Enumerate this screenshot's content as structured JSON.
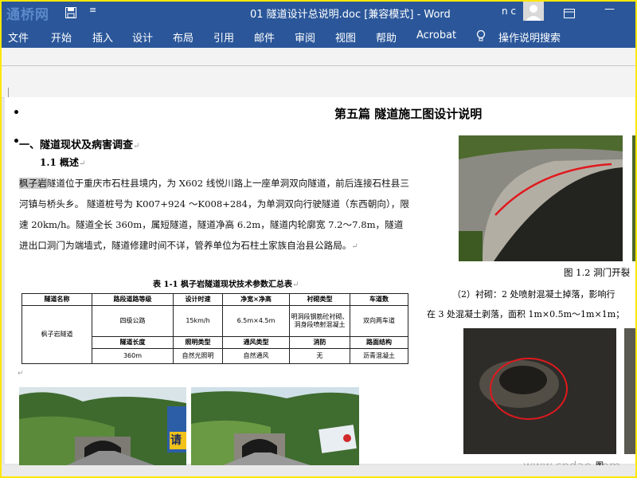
{
  "titlebar": {
    "watermark": "通桥网",
    "qat_more": "≡",
    "doc_title": "01 隧道设计总说明.doc [兼容模式]  -  Word",
    "user_name": "n c",
    "minimize": "—"
  },
  "colors": {
    "accent": "#2b579a",
    "highlight": "#c9c9c9",
    "yellow_frame": "#ffe600"
  },
  "ribbon": {
    "tabs": [
      "文件",
      "开始",
      "插入",
      "设计",
      "布局",
      "引用",
      "邮件",
      "审阅",
      "视图",
      "帮助",
      "Acrobat"
    ],
    "tell_me": "操作说明搜索"
  },
  "doc": {
    "bullet": "•",
    "part_title": "第五篇  隧道施工图设计说明",
    "section_heading": "一、隧道现状及病害调查",
    "subsection_heading": "1.1  概述",
    "para_mark": "↵",
    "paragraph_highlight": "枫子岩",
    "paragraph_text": "隧道位于重庆市石柱县境内，为 X602 线悦川路上一座单洞双向隧道，前后连接石柱县三河镇与桥头乡。 隧道桩号为 K007+924 ～K008+284，为单洞双向行驶隧道（东西朝向），限速 20km/h。隧道全长 360m，属短隧道，隧道净高 6.2m，隧道内轮廓宽 7.2～7.8m，隧道进出口洞门为端墙式，隧道修建时间不详，管养单位为石柱土家族自治县公路局。",
    "table_caption": "表 1-1  枫子岩隧道现状技术参数汇总表",
    "table": {
      "row1_headers": [
        "隧道名称",
        "路段道路等级",
        "设计时速",
        "净宽×净高",
        "衬砌类型",
        "车道数"
      ],
      "tunnel_name": "枫子岩隧道",
      "row2": [
        "四级公路",
        "15km/h",
        "6.5m×4.5m",
        "明洞段钢筋砼衬砌、洞身段喷射混凝土",
        "双向两车道"
      ],
      "row3_headers": [
        "隧道长度",
        "照明类型",
        "通风类型",
        "消防",
        "路面结构"
      ],
      "row4": [
        "360m",
        "自然光照明",
        "自然通风",
        "无",
        "沥青混凝土"
      ]
    },
    "fig_caption": "图 1.2  洞门开裂",
    "right_line1": "（2）衬砌：2 处喷射混凝土掉落，影响行",
    "right_line2": "在 3 处混凝土剥落，面积 1m×0.5m～1m×1m；",
    "sign_text": "请",
    "watermark2": "www.cndao.com",
    "fig_bottom_label": "图"
  }
}
